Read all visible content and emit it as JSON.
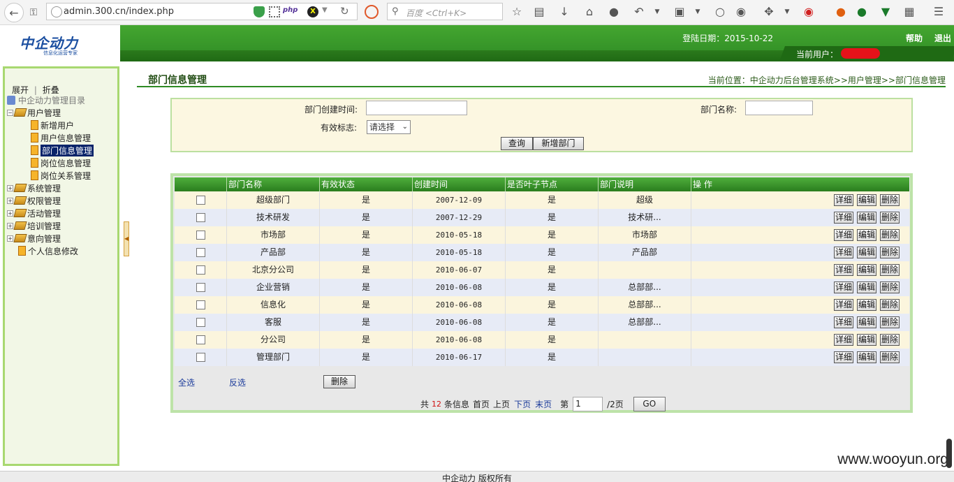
{
  "browser": {
    "url": "admin.300.cn/index.php",
    "search_placeholder": "百度 <Ctrl+K>",
    "php_badge": "php"
  },
  "header": {
    "logo_text": "中企动力",
    "logo_sub": "信息化运营专家",
    "login_date": "登陆日期：2015-10-22",
    "help": "帮助",
    "logout": "退出",
    "current_user_label": "当前用户："
  },
  "sidebar": {
    "expand": "展开",
    "sep": "|",
    "collapse": "折叠",
    "root": "中企动力管理目录",
    "groups": [
      {
        "label": "用户管理",
        "expanded": true,
        "children": [
          "新增用户",
          "用户信息管理",
          "部门信息管理",
          "岗位信息管理",
          "岗位关系管理"
        ]
      },
      {
        "label": "系统管理"
      },
      {
        "label": "权限管理"
      },
      {
        "label": "活动管理"
      },
      {
        "label": "培训管理"
      },
      {
        "label": "意向管理"
      }
    ],
    "personal": "个人信息修改",
    "selected": "部门信息管理"
  },
  "main": {
    "title": "部门信息管理",
    "breadcrumb": "当前位置：中企动力后台管理系统>>用户管理>>部门信息管理"
  },
  "search": {
    "create_time_label": "部门创建时间:",
    "name_label": "部门名称:",
    "status_label": "有效标志:",
    "status_value": "请选择",
    "query_btn": "查询",
    "add_btn": "新增部门"
  },
  "table": {
    "columns": [
      "",
      "部门名称",
      "有效状态",
      "创建时间",
      "是否叶子节点",
      "部门说明",
      "操 作"
    ],
    "rows": [
      [
        "超级部门",
        "是",
        "2007-12-09",
        "是",
        "超级"
      ],
      [
        "技术研发",
        "是",
        "2007-12-29",
        "是",
        "技术研..."
      ],
      [
        "市场部",
        "是",
        "2010-05-18",
        "是",
        "市场部"
      ],
      [
        "产品部",
        "是",
        "2010-05-18",
        "是",
        "产品部"
      ],
      [
        "北京分公司",
        "是",
        "2010-06-07",
        "是",
        ""
      ],
      [
        "企业营销",
        "是",
        "2010-06-08",
        "是",
        "总部部..."
      ],
      [
        "信息化",
        "是",
        "2010-06-08",
        "是",
        "总部部..."
      ],
      [
        "客服",
        "是",
        "2010-06-08",
        "是",
        "总部部..."
      ],
      [
        "分公司",
        "是",
        "2010-06-08",
        "是",
        ""
      ],
      [
        "管理部门",
        "是",
        "2010-06-17",
        "是",
        ""
      ]
    ],
    "ops": [
      "详细",
      "编辑",
      "删除"
    ],
    "select_all": "全选",
    "invert": "反选",
    "delete_btn": "删除"
  },
  "pager": {
    "prefix": "共",
    "total": "12",
    "suffix": "条信息",
    "first": "首页",
    "prev": "上页",
    "next": "下页",
    "last": "末页",
    "page_label": "第",
    "page_value": "1",
    "page_total": "/2页",
    "go": "GO"
  },
  "footer": {
    "copyright": "中企动力 版权所有",
    "watermark": "www.wooyun.org"
  },
  "colors": {
    "header_green": "#2e8b24",
    "panel_cream": "#fcf7e1",
    "row_blue": "#e7ebf6",
    "link_blue": "#1a3a9a",
    "total_red": "#d01010"
  }
}
